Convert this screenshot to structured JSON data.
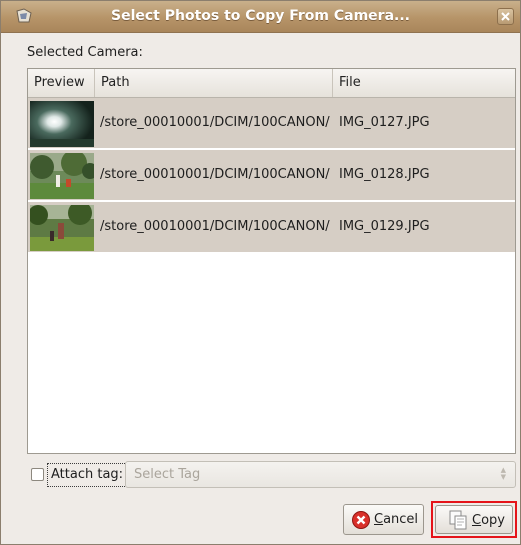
{
  "window": {
    "title": "Select Photos to Copy From Camera..."
  },
  "camera_label": "Selected Camera:",
  "columns": [
    "Preview",
    "Path",
    "File"
  ],
  "rows": [
    {
      "path": "/store_00010001/DCIM/100CANON/",
      "file": "IMG_0127.JPG"
    },
    {
      "path": "/store_00010001/DCIM/100CANON/",
      "file": "IMG_0128.JPG"
    },
    {
      "path": "/store_00010001/DCIM/100CANON/",
      "file": "IMG_0129.JPG"
    }
  ],
  "attach_tag": {
    "label": "Attach tag:",
    "checked": false,
    "select_placeholder": "Select Tag"
  },
  "buttons": {
    "cancel_mnemonic": "C",
    "cancel_rest": "ancel",
    "copy_mnemonic": "C",
    "copy_rest": "opy"
  },
  "colors": {
    "selected_row": "#d6cec5",
    "highlight": "#e5141a",
    "titlebar": "#b69468"
  }
}
